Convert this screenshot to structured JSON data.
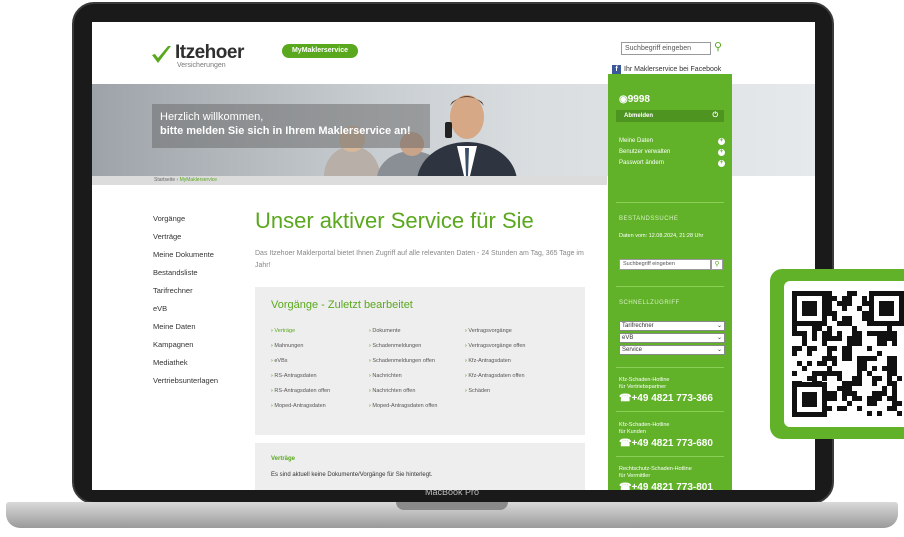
{
  "header": {
    "logo_name": "Itzehoer",
    "logo_sub": "Versicherungen",
    "mymakler_label": "MyMaklerservice",
    "search_placeholder": "Suchbegriff eingeben",
    "facebook_text": "Ihr Maklerservice bei Facebook"
  },
  "hero": {
    "welcome_line1": "Herzlich willkommen,",
    "welcome_line2": "bitte melden Sie sich in Ihrem Maklerservice an!"
  },
  "breadcrumb": {
    "home": "Startseite",
    "separator": " › ",
    "current": "MyMaklerservice"
  },
  "left_nav": [
    "Vorgänge",
    "Verträge",
    "Meine Dokumente",
    "Bestandsliste",
    "Tarifrechner",
    "eVB",
    "Meine Daten",
    "Kampagnen",
    "Mediathek",
    "Vertriebsunterlagen"
  ],
  "main": {
    "title": "Unser aktiver Service für Sie",
    "intro": "Das Itzehoer Maklerportal bietet Ihnen Zugriff auf alle relevanten Daten - 24 Stunden am Tag, 365 Tage im Jahr!",
    "box1_title": "Vorgänge - Zuletzt bearbeitet",
    "box1_col1": [
      "Verträge",
      "Mahnungen",
      "eVBs",
      "RS-Antragsdaten",
      "RS-Antragsdaten offen",
      "Moped-Antragsdaten"
    ],
    "box1_col2": [
      "Dokumente",
      "Schadenmeldungen",
      "Schadenmeldungen offen",
      "Nachrichten",
      "Nachrichten offen",
      "Moped-Antragsdaten offen"
    ],
    "box1_col3": [
      "Vertragsvorgänge",
      "Vertragsvorgänge offen",
      "Kfz-Antragsdaten",
      "Kfz-Antragsdaten offen",
      "Schäden"
    ],
    "box2_title": "Verträge",
    "box2_text": "Es sind aktuell keine Dokumente/Vorgänge für Sie hinterlegt."
  },
  "sidebar": {
    "id": "9998",
    "login_label": "Abmelden",
    "links": [
      "Meine Daten",
      "Benutzer verwalten",
      "Passwort ändern"
    ],
    "bestand_head": "BESTANDSSUCHE",
    "bestand_date": "Daten vom: 12.08.2024, 21:28 Uhr",
    "bestand_search": "Suchbegriff eingeben",
    "schnell_head": "SCHNELLZUGRIFF",
    "selects": [
      "Tarifrechner",
      "eVB",
      "Service"
    ],
    "hotlines": [
      {
        "label1": "Kfz-Schaden-Hotline",
        "label2": "für Vertriebspartner",
        "phone": "+49 4821 773-366"
      },
      {
        "label1": "Kfz-Schaden-Hotline",
        "label2": "für Kunden",
        "phone": "+49 4821 773-680"
      },
      {
        "label1": "Rechtschutz-Schaden-Hotline",
        "label2": "für Vermittler",
        "phone": "+49 4821 773-801"
      }
    ]
  },
  "device": {
    "label": "MacBook Pro"
  },
  "colors": {
    "brand_green": "#61b229",
    "title_green": "#5aa81e"
  }
}
